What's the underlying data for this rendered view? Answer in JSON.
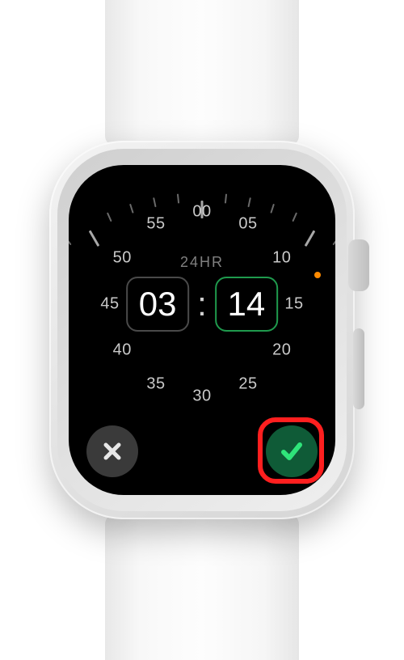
{
  "mode_label": "24HR",
  "hour": "03",
  "minute": "14",
  "colon": ":",
  "dial_numbers": [
    "00",
    "05",
    "10",
    "15",
    "20",
    "25",
    "30",
    "35",
    "40",
    "45",
    "50",
    "55"
  ],
  "status": {
    "mic_active": true
  },
  "buttons": {
    "cancel_name": "cancel",
    "confirm_name": "confirm"
  }
}
